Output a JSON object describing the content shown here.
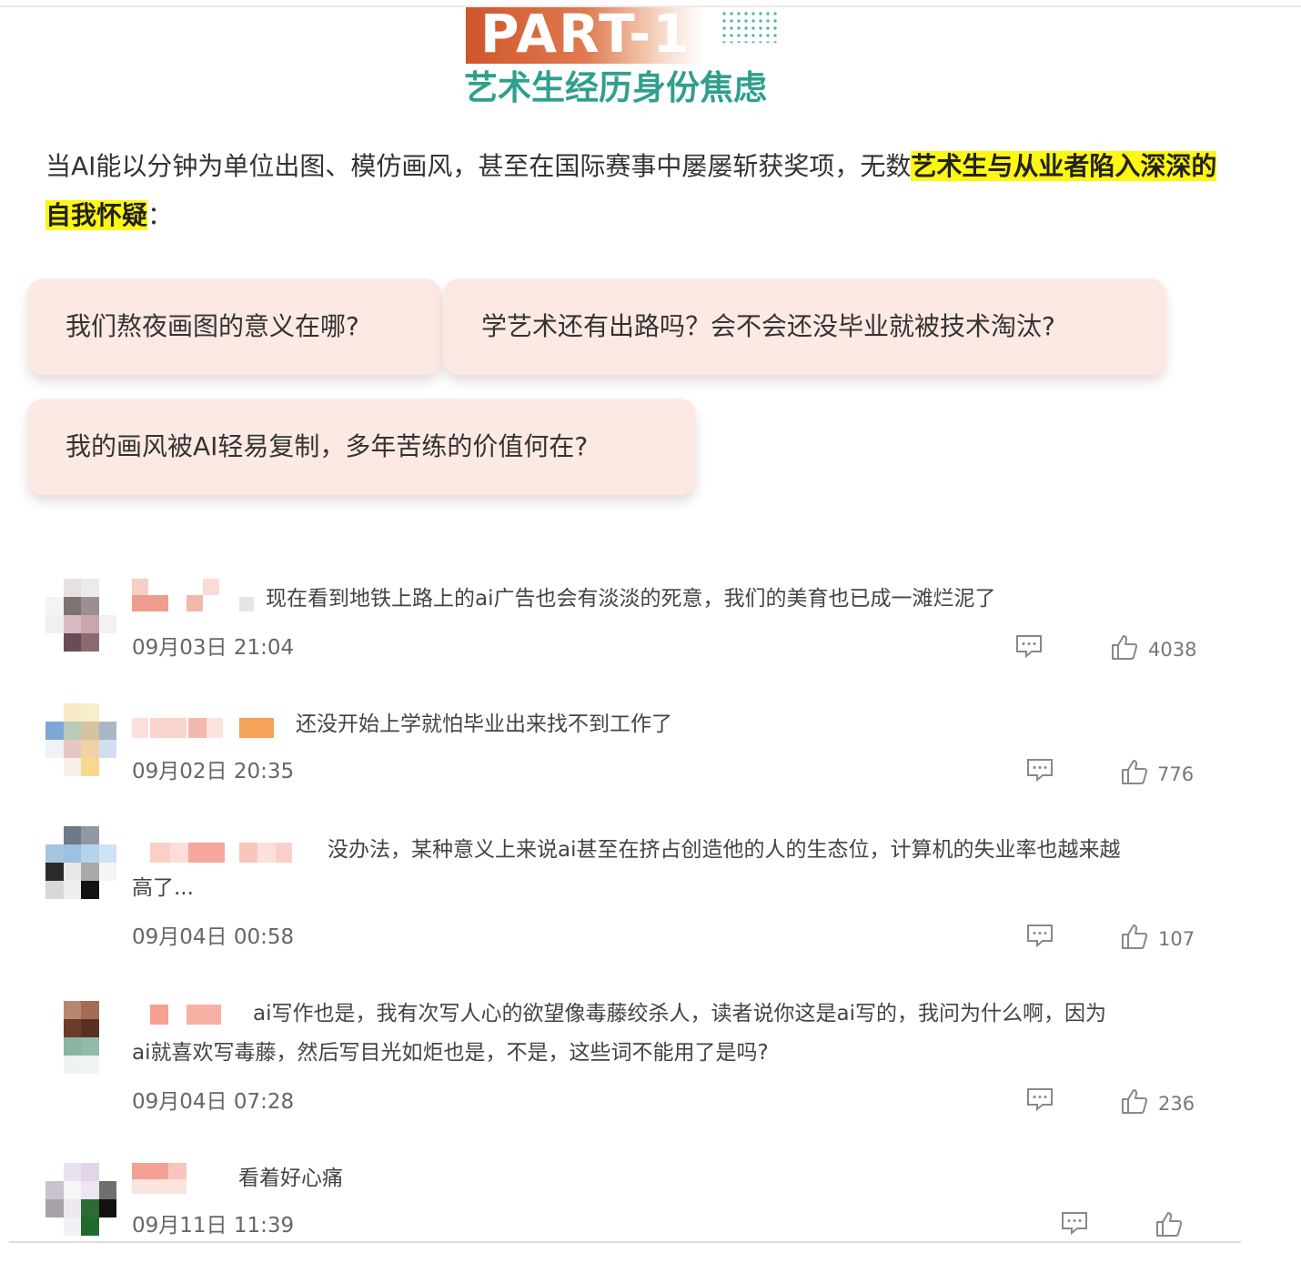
{
  "header": {
    "part_label": "PART-1",
    "section_title": "艺术生经历身份焦虑"
  },
  "intro": {
    "text_before": "当AI能以分钟为单位出图、模仿画风，甚至在国际赛事中屡屡斩获奖项，无数",
    "highlight": "艺术生与从业者陷入深深的自我怀疑",
    "text_after": "："
  },
  "questions": [
    "我们熬夜画图的意义在哪?",
    "学艺术还有出路吗？会不会还没毕业就被技术淘汰?",
    "我的画风被AI轻易复制，多年苦练的价值何在?"
  ],
  "comments": [
    {
      "text": "现在看到地铁上路上的ai广告也会有淡淡的死意，我们的美育也已成一滩烂泥了",
      "time": "09月03日 21:04",
      "likes": "4038"
    },
    {
      "text": "还没开始上学就怕毕业出来找不到工作了",
      "time": "09月02日 20:35",
      "likes": "776"
    },
    {
      "text_line1": "没办法，某种意义上来说ai甚至在挤占创造他的人的生态位，计算机的失业率也越来越",
      "text_line2": "高了...",
      "time": "09月04日 00:58",
      "likes": "107"
    },
    {
      "text_line1": "ai写作也是，我有次写人心的欲望像毒藤绞杀人，读者说你这是ai写的，我问为什么啊，因为",
      "text_line2": "ai就喜欢写毒藤，然后写目光如炬也是，不是，这些词不能用了是吗?",
      "time": "09月04日 07:28",
      "likes": "236"
    },
    {
      "text": "看着好心痛",
      "time": "09月11日 11:39",
      "likes": ""
    }
  ],
  "icons": {
    "reply": "comment-bubble-icon",
    "like": "thumbs-up-icon"
  },
  "colors": {
    "title_teal": "#2f9f8e",
    "badge_orange": "#d0552b",
    "highlight_yellow": "#fdf712",
    "card_pink": "#fde9e3"
  }
}
